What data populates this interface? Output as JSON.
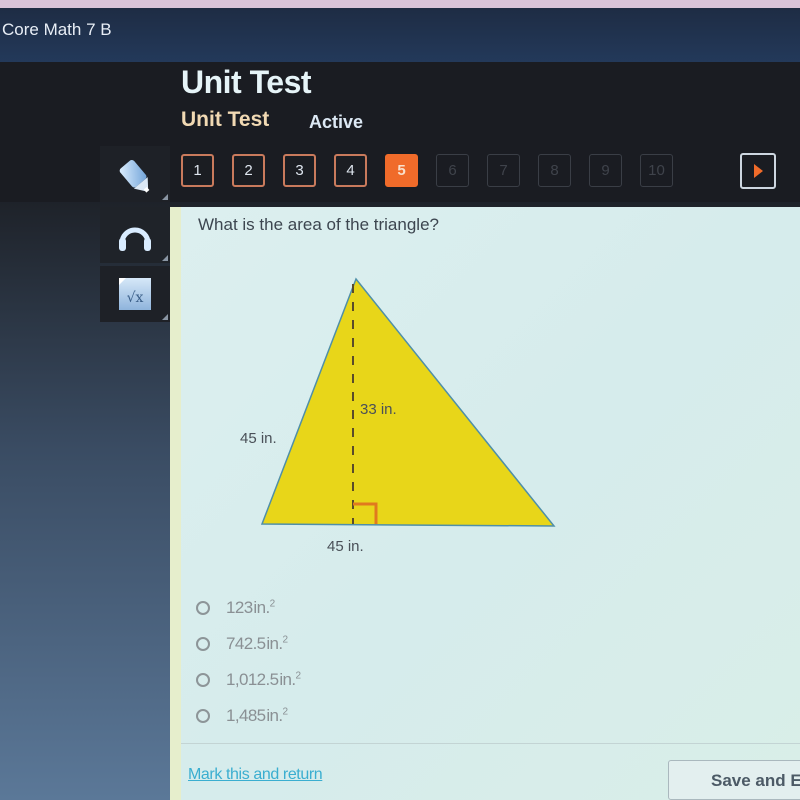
{
  "course": {
    "title": "Core Math 7 B"
  },
  "header": {
    "title": "Unit Test",
    "subtitle": "Unit Test",
    "status": "Active"
  },
  "question_nav": {
    "items": [
      {
        "label": "1",
        "state": "answered"
      },
      {
        "label": "2",
        "state": "answered"
      },
      {
        "label": "3",
        "state": "answered"
      },
      {
        "label": "4",
        "state": "answered"
      },
      {
        "label": "5",
        "state": "current"
      },
      {
        "label": "6",
        "state": "disabled"
      },
      {
        "label": "7",
        "state": "disabled"
      },
      {
        "label": "8",
        "state": "disabled"
      },
      {
        "label": "9",
        "state": "disabled"
      },
      {
        "label": "10",
        "state": "disabled"
      }
    ],
    "next_icon": "play-right-icon"
  },
  "tools": [
    {
      "name": "pencil-icon"
    },
    {
      "name": "headphones-icon"
    },
    {
      "name": "math-sqrt-icon"
    }
  ],
  "question": {
    "text": "What is the area of the triangle?",
    "figure": {
      "side_label": "45 in.",
      "height_label": "33 in.",
      "base_label": "45 in.",
      "fill_color": "#e8d619",
      "right_angle_color": "#e07a1e"
    },
    "answers": [
      {
        "value": "123",
        "unit": "in.",
        "exp": "2"
      },
      {
        "value": "742.5",
        "unit": "in.",
        "exp": "2"
      },
      {
        "value": "1,012.5",
        "unit": "in.",
        "exp": "2"
      },
      {
        "value": "1,485",
        "unit": "in.",
        "exp": "2"
      }
    ]
  },
  "footer": {
    "mark_link": "Mark this and return",
    "save_button": "Save and E"
  },
  "colors": {
    "accent": "#f06b2a",
    "link": "#3aaed0"
  }
}
